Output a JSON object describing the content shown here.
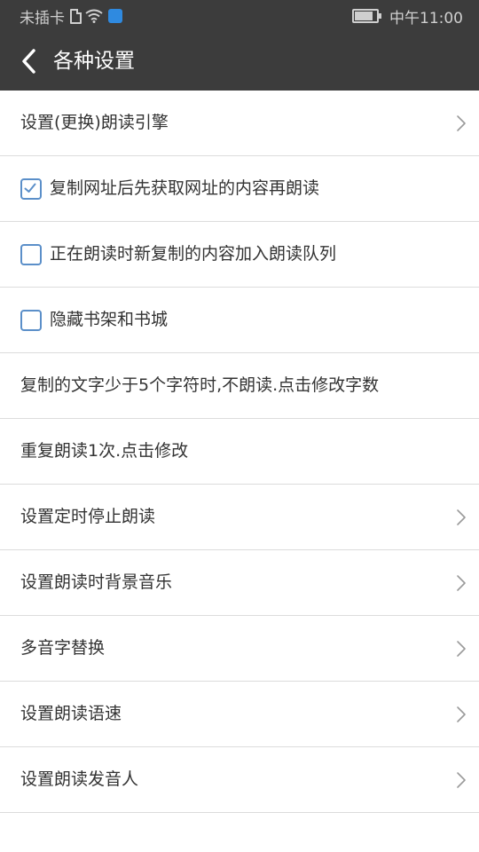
{
  "status_bar": {
    "carrier": "未插卡",
    "time": "中午11:00",
    "battery_level": 0.85,
    "icons": [
      "sim-icon",
      "wifi-icon",
      "app-notification-icon",
      "battery-icon"
    ]
  },
  "app_bar": {
    "title": "各种设置",
    "back_icon": "chevron-left-icon"
  },
  "colors": {
    "app_bar_bg": "#3c3c3c",
    "checkbox_border": "#5b8fc9",
    "divider": "#dcdcdc",
    "text": "#333333"
  },
  "settings": {
    "items": [
      {
        "label": "设置(更换)朗读引擎",
        "type": "nav"
      },
      {
        "label": "复制网址后先获取网址的内容再朗读",
        "type": "checkbox",
        "checked": true
      },
      {
        "label": "正在朗读时新复制的内容加入朗读队列",
        "type": "checkbox",
        "checked": false
      },
      {
        "label": "隐藏书架和书城",
        "type": "checkbox",
        "checked": false
      },
      {
        "label": "复制的文字少于5个字符时,不朗读.点击修改字数",
        "type": "action"
      },
      {
        "label": "重复朗读1次.点击修改",
        "type": "action"
      },
      {
        "label": "设置定时停止朗读",
        "type": "nav"
      },
      {
        "label": "设置朗读时背景音乐",
        "type": "nav"
      },
      {
        "label": "多音字替换",
        "type": "nav"
      },
      {
        "label": "设置朗读语速",
        "type": "nav"
      },
      {
        "label": "设置朗读发音人",
        "type": "nav"
      }
    ]
  }
}
